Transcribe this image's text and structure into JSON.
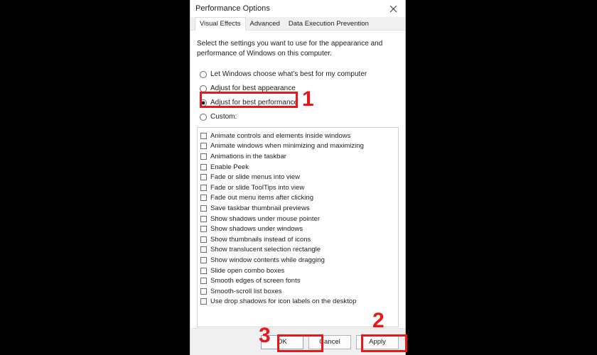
{
  "window": {
    "title": "Performance Options",
    "close_icon": "close-icon"
  },
  "tabs": [
    {
      "label": "Visual Effects",
      "active": true
    },
    {
      "label": "Advanced",
      "active": false
    },
    {
      "label": "Data Execution Prevention",
      "active": false
    }
  ],
  "content": {
    "intro": "Select the settings you want to use for the appearance and performance of Windows on this computer.",
    "radios": [
      {
        "label": "Let Windows choose what's best for my computer",
        "checked": false
      },
      {
        "label": "Adjust for best appearance",
        "checked": false
      },
      {
        "label": "Adjust for best performance",
        "checked": true
      },
      {
        "label": "Custom:",
        "checked": false
      }
    ],
    "checkboxes": [
      {
        "label": "Animate controls and elements inside windows",
        "checked": false
      },
      {
        "label": "Animate windows when minimizing and maximizing",
        "checked": false
      },
      {
        "label": "Animations in the taskbar",
        "checked": false
      },
      {
        "label": "Enable Peek",
        "checked": false
      },
      {
        "label": "Fade or slide menus into view",
        "checked": false
      },
      {
        "label": "Fade or slide ToolTips into view",
        "checked": false
      },
      {
        "label": "Fade out menu items after clicking",
        "checked": false
      },
      {
        "label": "Save taskbar thumbnail previews",
        "checked": false
      },
      {
        "label": "Show shadows under mouse pointer",
        "checked": false
      },
      {
        "label": "Show shadows under windows",
        "checked": false
      },
      {
        "label": "Show thumbnails instead of icons",
        "checked": false
      },
      {
        "label": "Show translucent selection rectangle",
        "checked": false
      },
      {
        "label": "Show window contents while dragging",
        "checked": false
      },
      {
        "label": "Slide open combo boxes",
        "checked": false
      },
      {
        "label": "Smooth edges of screen fonts",
        "checked": false
      },
      {
        "label": "Smooth-scroll list boxes",
        "checked": false
      },
      {
        "label": "Use drop shadows for icon labels on the desktop",
        "checked": false
      }
    ]
  },
  "footer": {
    "ok_label": "OK",
    "cancel_label": "Cancel",
    "apply_label": "Apply"
  },
  "annotations": {
    "accent_color": "#e81818",
    "steps": [
      {
        "number": "1",
        "target": "adjust-for-best-performance-radio"
      },
      {
        "number": "2",
        "target": "apply-button"
      },
      {
        "number": "3",
        "target": "ok-button"
      }
    ]
  }
}
